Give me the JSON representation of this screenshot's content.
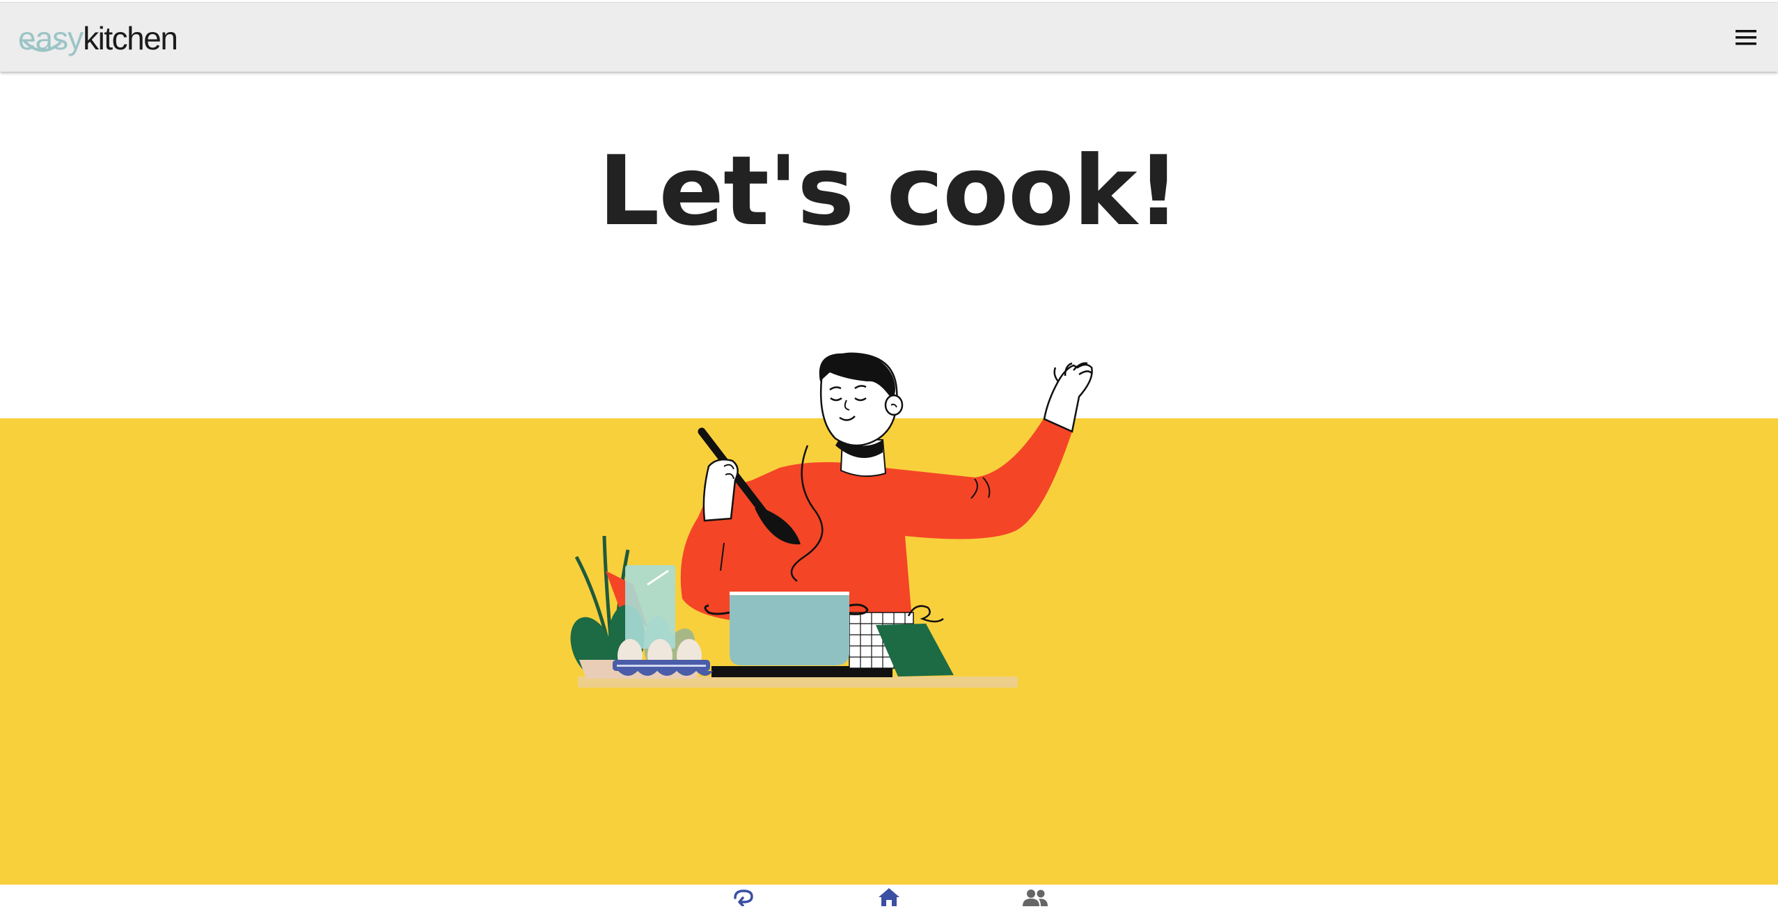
{
  "header": {
    "logo": {
      "part1": "easy",
      "part2": "kitchen"
    },
    "menu_icon": "hamburger-menu-icon"
  },
  "hero": {
    "title": "Let's cook!"
  },
  "bottom_nav": {
    "items": [
      {
        "icon": "history-icon"
      },
      {
        "icon": "home-icon",
        "active": true
      },
      {
        "icon": "people-icon"
      }
    ]
  },
  "colors": {
    "header_bg": "#ededed",
    "band": "#f8d03c",
    "logo_easy": "#9cc4c6",
    "active_nav": "#3b4fa3",
    "inactive_nav": "#666666",
    "shirt": "#f44527",
    "pot": "#8fc1c2"
  }
}
